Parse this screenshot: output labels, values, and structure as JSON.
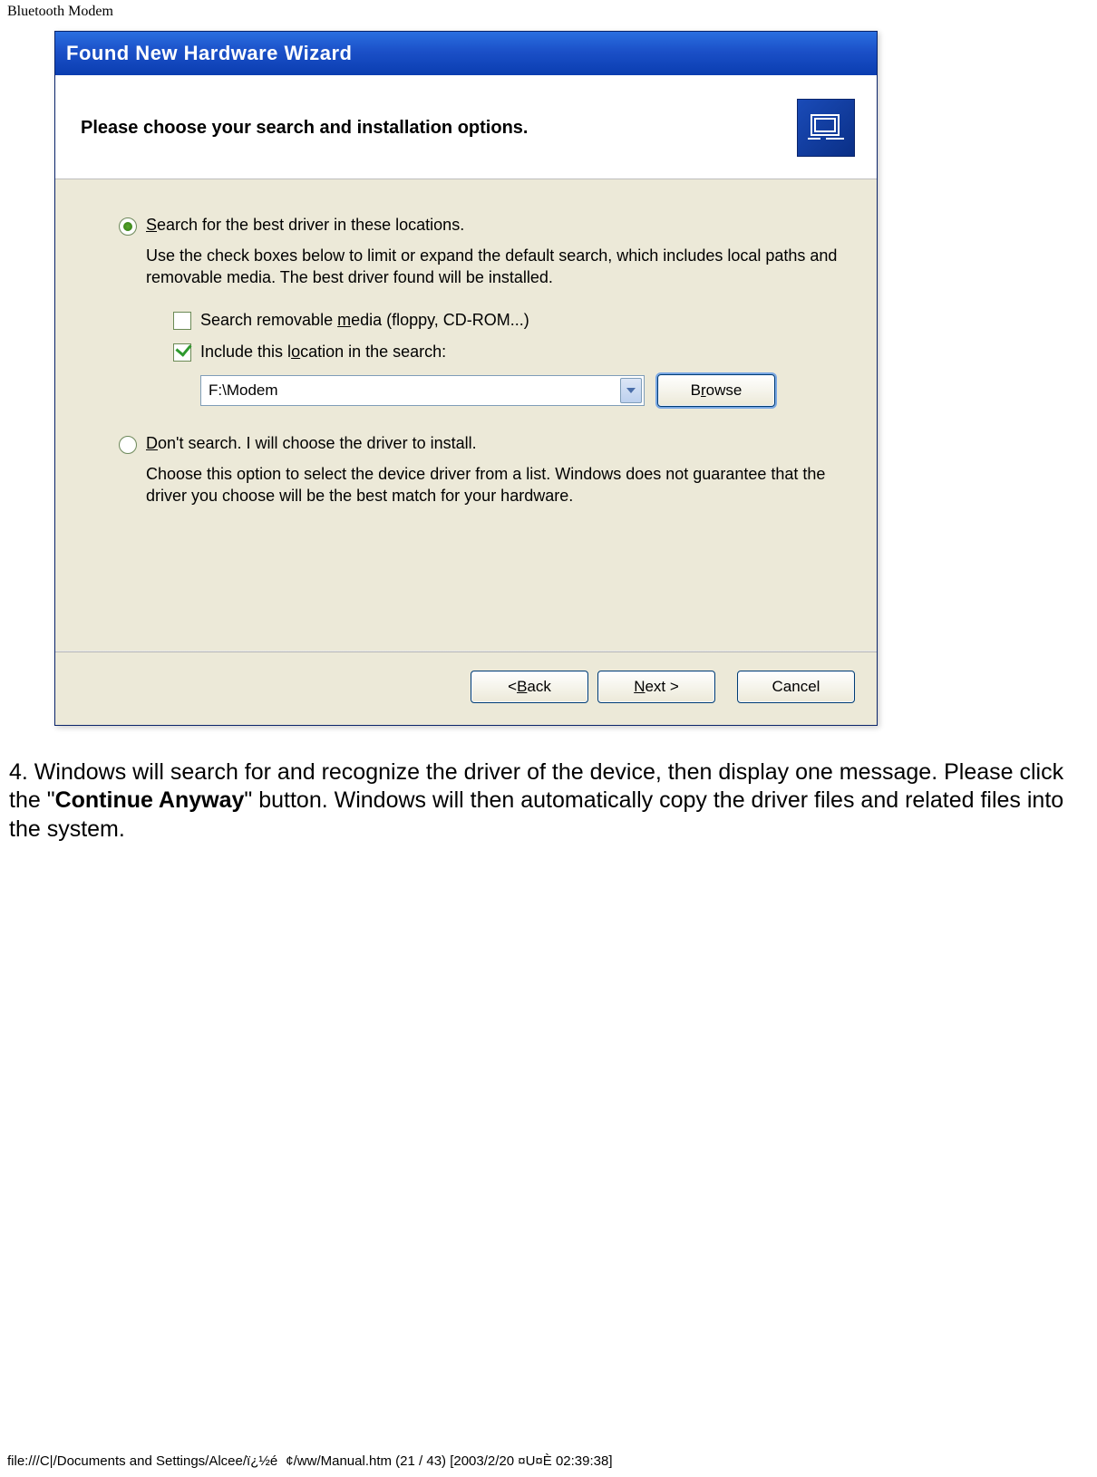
{
  "page": {
    "header": "Bluetooth Modem",
    "footer": "file:///C|/Documents and Settings/Alcee/ï¿½é¢/ww/Manual.htm (21 / 43) [2003/2/20 ¤U¤È 02:39:38]"
  },
  "wizard": {
    "title": "Found New Hardware Wizard",
    "banner_title": "Please choose your search and installation options.",
    "radio1": {
      "label_pre": "",
      "letter": "S",
      "label_post": "earch for the best driver in these locations.",
      "explain": "Use the check boxes below to limit or expand the default search, which includes local paths and removable media. The best driver found will be installed."
    },
    "checks": {
      "c1_pre": "Search removable ",
      "c1_letter": "m",
      "c1_post": "edia (floppy, CD-ROM...)",
      "c2_pre": "Include this l",
      "c2_letter": "o",
      "c2_post": "cation in the search:"
    },
    "path_value": "F:\\Modem",
    "browse_pre": "B",
    "browse_letter": "r",
    "browse_post": "owse",
    "radio2": {
      "letter": "D",
      "label_post": "on't search. I will choose the driver to install.",
      "explain": "Choose this option to select the device driver from a list.  Windows does not guarantee that the driver you choose will be the best match for your hardware."
    },
    "buttons": {
      "back_pre": "< ",
      "back_letter": "B",
      "back_post": "ack",
      "next_pre": "",
      "next_letter": "N",
      "next_post": "ext >",
      "cancel": "Cancel"
    }
  },
  "body_text": {
    "p1a": "4. Windows will search for and recognize the driver of the device, then display one message. Please click the \"",
    "p1b": "Continue Anyway",
    "p1c": "\" button. Windows will then automatically copy the driver files and related files into the system."
  }
}
